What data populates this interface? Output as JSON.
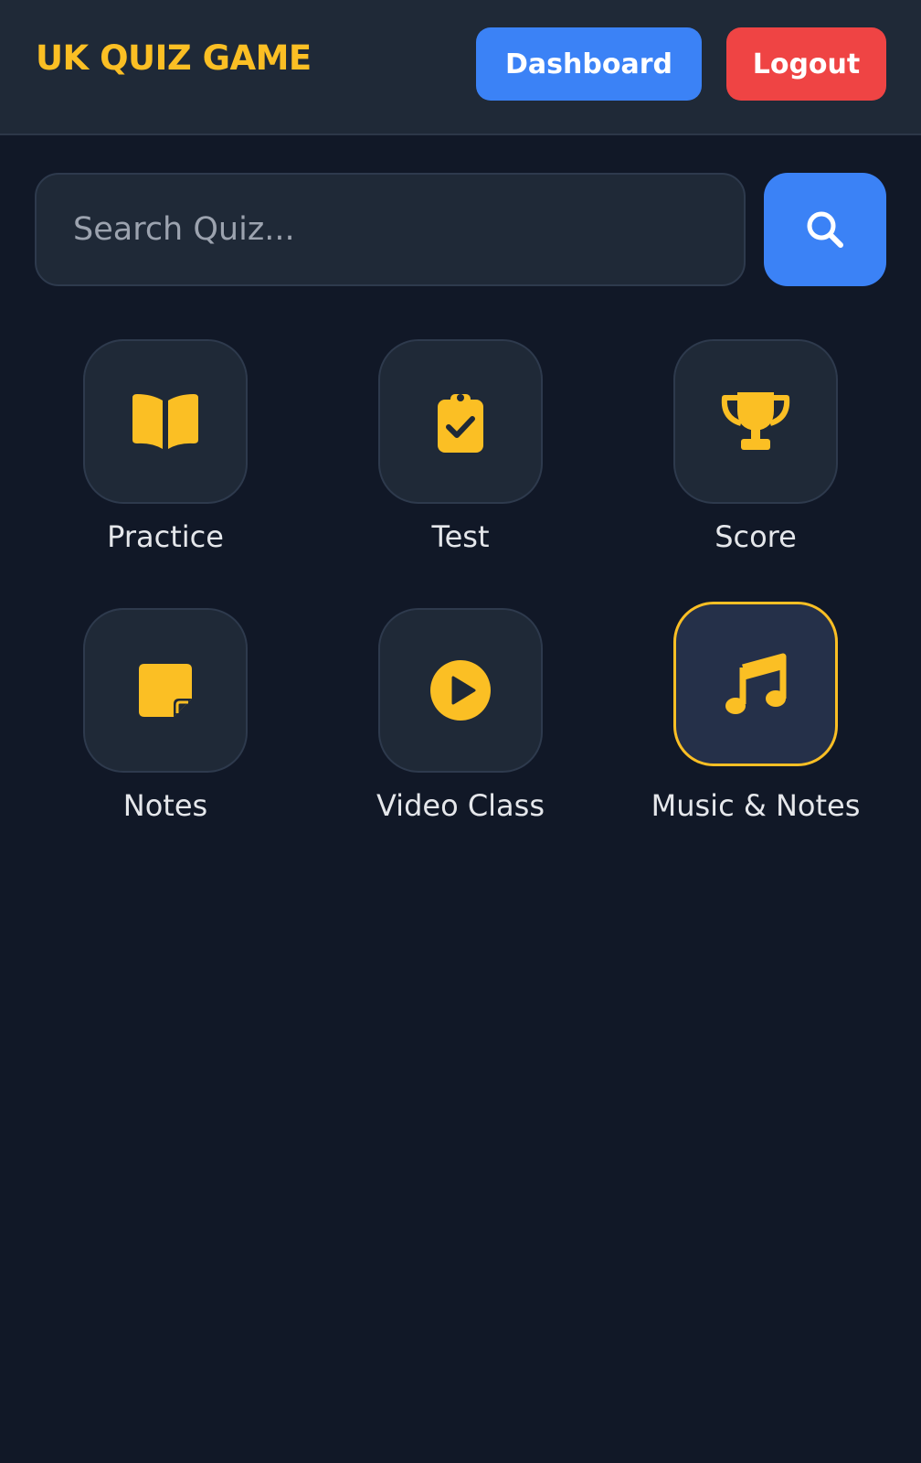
{
  "header": {
    "brand": "UK QUIZ GAME",
    "dashboard_label": "Dashboard",
    "logout_label": "Logout"
  },
  "search": {
    "placeholder": "Search Quiz...",
    "value": "",
    "button_icon": "search-icon"
  },
  "menu": {
    "items": [
      {
        "label": "Practice",
        "icon": "book-open-icon"
      },
      {
        "label": "Test",
        "icon": "clipboard-check-icon"
      },
      {
        "label": "Score",
        "icon": "trophy-icon"
      },
      {
        "label": "Notes",
        "icon": "sticky-note-icon"
      },
      {
        "label": "Video Class",
        "icon": "play-circle-icon"
      },
      {
        "label": "Music & Notes",
        "icon": "music-icon",
        "active": true
      }
    ]
  },
  "colors": {
    "background": "#111827",
    "surface": "#1f2937",
    "accent": "#fbbf24",
    "primary": "#3b82f6",
    "danger": "#ef4444"
  }
}
